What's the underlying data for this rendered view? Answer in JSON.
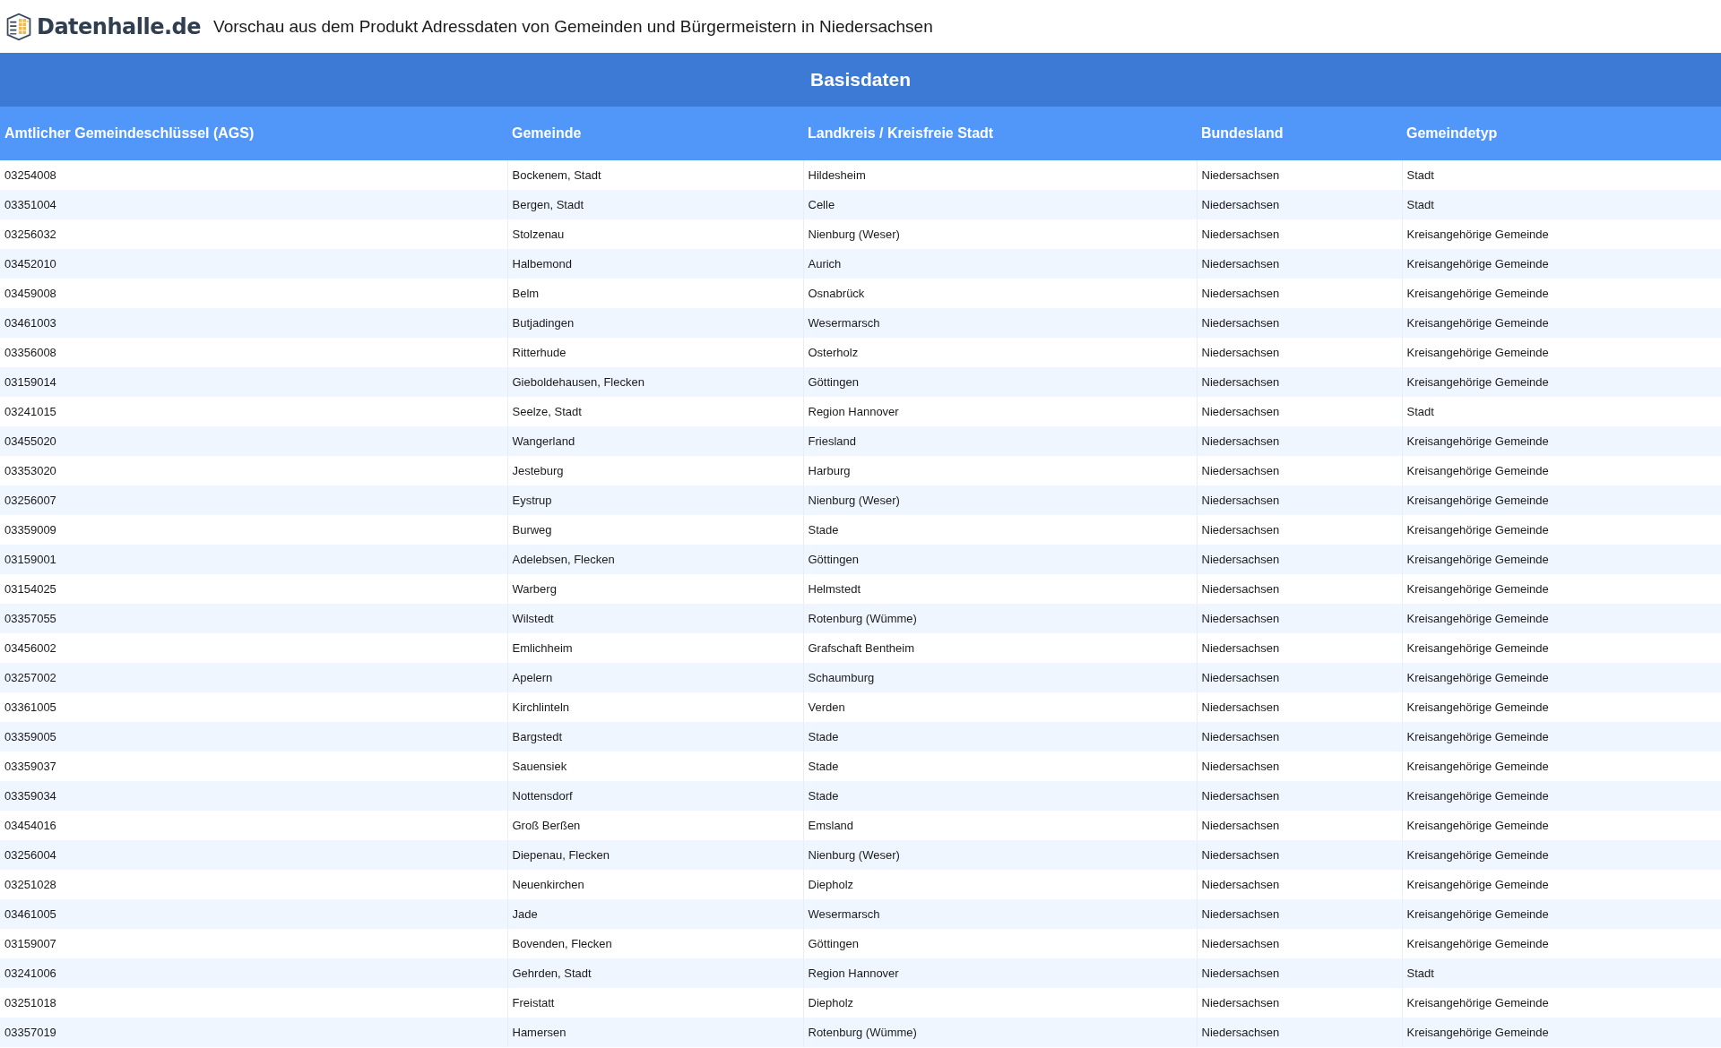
{
  "header": {
    "logo_text": "Datenhalle.de",
    "title": "Vorschau aus dem Produkt Adressdaten von Gemeinden und Bürgermeistern in Niedersachsen"
  },
  "table": {
    "caption": "Basisdaten",
    "columns": [
      "Amtlicher Gemeindeschlüssel (AGS)",
      "Gemeinde",
      "Landkreis / Kreisfreie Stadt",
      "Bundesland",
      "Gemeindetyp"
    ],
    "rows": [
      [
        "03254008",
        "Bockenem, Stadt",
        "Hildesheim",
        "Niedersachsen",
        "Stadt"
      ],
      [
        "03351004",
        "Bergen, Stadt",
        "Celle",
        "Niedersachsen",
        "Stadt"
      ],
      [
        "03256032",
        "Stolzenau",
        "Nienburg (Weser)",
        "Niedersachsen",
        "Kreisangehörige Gemeinde"
      ],
      [
        "03452010",
        "Halbemond",
        "Aurich",
        "Niedersachsen",
        "Kreisangehörige Gemeinde"
      ],
      [
        "03459008",
        "Belm",
        "Osnabrück",
        "Niedersachsen",
        "Kreisangehörige Gemeinde"
      ],
      [
        "03461003",
        "Butjadingen",
        "Wesermarsch",
        "Niedersachsen",
        "Kreisangehörige Gemeinde"
      ],
      [
        "03356008",
        "Ritterhude",
        "Osterholz",
        "Niedersachsen",
        "Kreisangehörige Gemeinde"
      ],
      [
        "03159014",
        "Gieboldehausen, Flecken",
        "Göttingen",
        "Niedersachsen",
        "Kreisangehörige Gemeinde"
      ],
      [
        "03241015",
        "Seelze, Stadt",
        "Region Hannover",
        "Niedersachsen",
        "Stadt"
      ],
      [
        "03455020",
        "Wangerland",
        "Friesland",
        "Niedersachsen",
        "Kreisangehörige Gemeinde"
      ],
      [
        "03353020",
        "Jesteburg",
        "Harburg",
        "Niedersachsen",
        "Kreisangehörige Gemeinde"
      ],
      [
        "03256007",
        "Eystrup",
        "Nienburg (Weser)",
        "Niedersachsen",
        "Kreisangehörige Gemeinde"
      ],
      [
        "03359009",
        "Burweg",
        "Stade",
        "Niedersachsen",
        "Kreisangehörige Gemeinde"
      ],
      [
        "03159001",
        "Adelebsen, Flecken",
        "Göttingen",
        "Niedersachsen",
        "Kreisangehörige Gemeinde"
      ],
      [
        "03154025",
        "Warberg",
        "Helmstedt",
        "Niedersachsen",
        "Kreisangehörige Gemeinde"
      ],
      [
        "03357055",
        "Wilstedt",
        "Rotenburg (Wümme)",
        "Niedersachsen",
        "Kreisangehörige Gemeinde"
      ],
      [
        "03456002",
        "Emlichheim",
        "Grafschaft Bentheim",
        "Niedersachsen",
        "Kreisangehörige Gemeinde"
      ],
      [
        "03257002",
        "Apelern",
        "Schaumburg",
        "Niedersachsen",
        "Kreisangehörige Gemeinde"
      ],
      [
        "03361005",
        "Kirchlinteln",
        "Verden",
        "Niedersachsen",
        "Kreisangehörige Gemeinde"
      ],
      [
        "03359005",
        "Bargstedt",
        "Stade",
        "Niedersachsen",
        "Kreisangehörige Gemeinde"
      ],
      [
        "03359037",
        "Sauensiek",
        "Stade",
        "Niedersachsen",
        "Kreisangehörige Gemeinde"
      ],
      [
        "03359034",
        "Nottensdorf",
        "Stade",
        "Niedersachsen",
        "Kreisangehörige Gemeinde"
      ],
      [
        "03454016",
        "Groß Berßen",
        "Emsland",
        "Niedersachsen",
        "Kreisangehörige Gemeinde"
      ],
      [
        "03256004",
        "Diepenau, Flecken",
        "Nienburg (Weser)",
        "Niedersachsen",
        "Kreisangehörige Gemeinde"
      ],
      [
        "03251028",
        "Neuenkirchen",
        "Diepholz",
        "Niedersachsen",
        "Kreisangehörige Gemeinde"
      ],
      [
        "03461005",
        "Jade",
        "Wesermarsch",
        "Niedersachsen",
        "Kreisangehörige Gemeinde"
      ],
      [
        "03159007",
        "Bovenden, Flecken",
        "Göttingen",
        "Niedersachsen",
        "Kreisangehörige Gemeinde"
      ],
      [
        "03241006",
        "Gehrden, Stadt",
        "Region Hannover",
        "Niedersachsen",
        "Stadt"
      ],
      [
        "03251018",
        "Freistatt",
        "Diepholz",
        "Niedersachsen",
        "Kreisangehörige Gemeinde"
      ],
      [
        "03357019",
        "Hamersen",
        "Rotenburg (Wümme)",
        "Niedersachsen",
        "Kreisangehörige Gemeinde"
      ]
    ]
  }
}
